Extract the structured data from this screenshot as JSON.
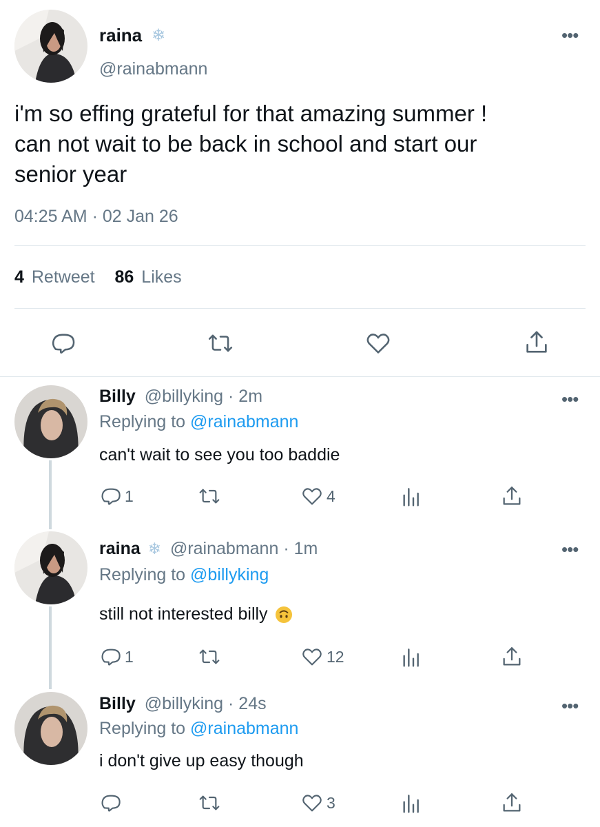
{
  "main_tweet": {
    "display_name": "raina",
    "handle": "@rainabmann",
    "text_lines": [
      "i'm so effing grateful for that amazing summer !",
      "can not wait to be back in school and start our",
      "senior year"
    ],
    "timestamp": "04:25 AM · 02 Jan 26",
    "retweet_count": "4",
    "retweet_label": "Retweet",
    "likes_count": "86",
    "likes_label": "Likes"
  },
  "replies": [
    {
      "display_name": "Billy",
      "handle": "@billyking",
      "time": "· 2m",
      "replying_prefix": "Replying to",
      "replying_handle": "@rainabmann",
      "text": "can't wait to see you too baddie",
      "reply_count": "1",
      "like_count": "4"
    },
    {
      "display_name": "raina",
      "handle": "@rainabmann",
      "time": "· 1m",
      "replying_prefix": "Replying to",
      "replying_handle": "@billyking",
      "text": "still not interested billy",
      "reply_count": "1",
      "like_count": "12"
    },
    {
      "display_name": "Billy",
      "handle": "@billyking",
      "time": "· 24s",
      "replying_prefix": "Replying to",
      "replying_handle": "@rainabmann",
      "text": "i don't give up easy though",
      "reply_count": "",
      "like_count": "3"
    }
  ],
  "colors": {
    "link_blue": "#1d9bf0",
    "secondary_text": "#657786",
    "divider": "#e1e8ed"
  }
}
